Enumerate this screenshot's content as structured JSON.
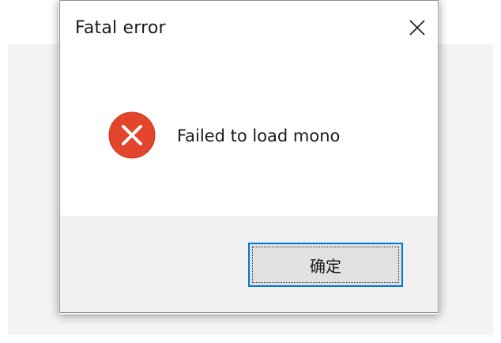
{
  "dialog": {
    "title": "Fatal error",
    "close_icon": "close-icon",
    "icon": "error-icon",
    "message": "Failed to load mono",
    "ok_label": "确定"
  },
  "colors": {
    "error_icon_fill": "#e2452b",
    "button_focus_border": "#0078d7",
    "footer_bg": "#f0f0f0"
  }
}
